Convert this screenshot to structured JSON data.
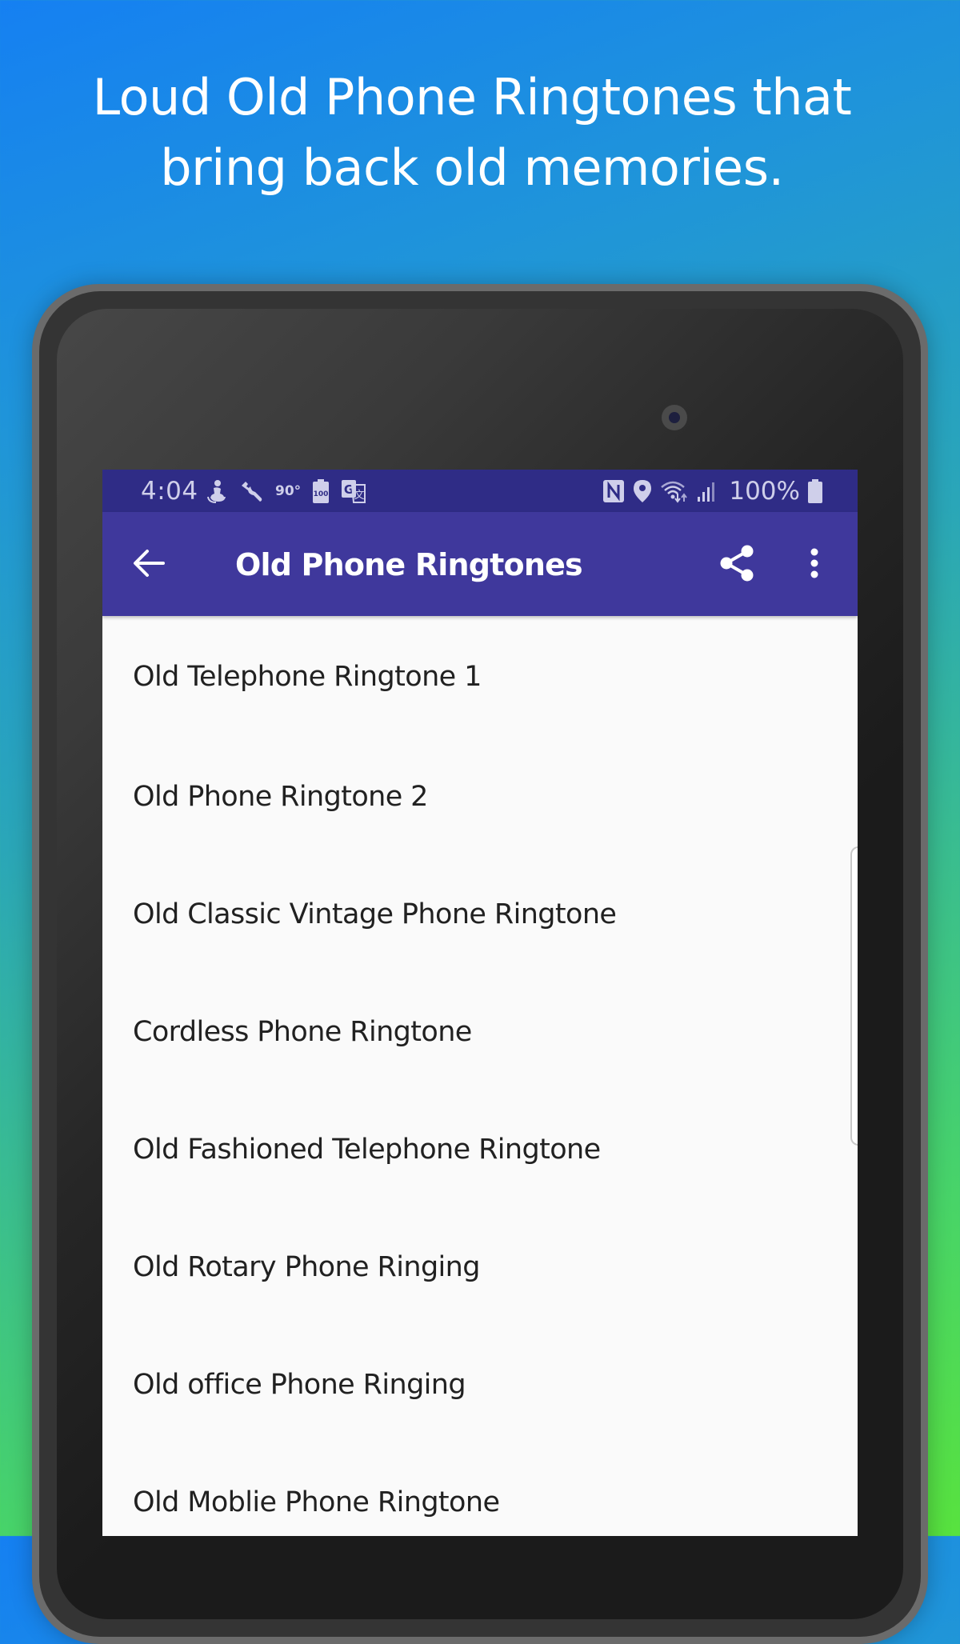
{
  "promo": {
    "headline_line1": "Loud Old Phone Ringtones that",
    "headline_line2": "bring back old memories."
  },
  "status_bar": {
    "time": "4:04",
    "left_icons": [
      "accessibility-icon",
      "wrench-icon",
      "temperature-90-icon",
      "battery-saver-100-icon",
      "translate-icon"
    ],
    "temperature": "90°",
    "battery_saver_label": "100",
    "right_icons": [
      "nfc-icon",
      "location-icon",
      "wifi-icon",
      "signal-icon",
      "battery-icon"
    ],
    "battery_percent": "100%"
  },
  "app_bar": {
    "title": "Old Phone Ringtones",
    "back_icon": "arrow-back-icon",
    "share_icon": "share-icon",
    "more_icon": "more-vert-icon",
    "color": "#3f389c",
    "status_color": "#2f2c86"
  },
  "ringtones": [
    {
      "label": "Old Telephone Ringtone 1"
    },
    {
      "label": "Old Phone Ringtone 2"
    },
    {
      "label": "Old Classic Vintage Phone Ringtone"
    },
    {
      "label": "Cordless Phone Ringtone"
    },
    {
      "label": "Old Fashioned Telephone Ringtone"
    },
    {
      "label": "Old Rotary Phone Ringing"
    },
    {
      "label": "Old office Phone Ringing"
    },
    {
      "label": "Old Moblie Phone Ringtone"
    }
  ]
}
